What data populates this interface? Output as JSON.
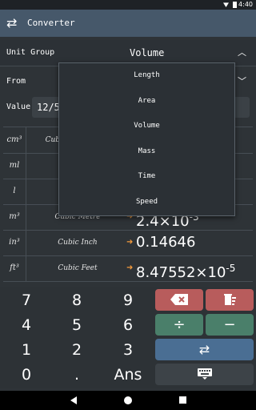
{
  "status": {
    "time": "4:40"
  },
  "app": {
    "title": "Converter",
    "icon": "swap-arrows-icon"
  },
  "unit_group": {
    "label": "Unit Group",
    "value": "Volume",
    "chevron": "^"
  },
  "from": {
    "label": "From",
    "chevron": "⌄"
  },
  "value": {
    "label": "Value",
    "text": "12/5"
  },
  "results": [
    {
      "symbol": "cm³",
      "name": "Cubic Centimetre",
      "arrow": "➜",
      "value": ""
    },
    {
      "symbol": "ml",
      "name": "",
      "arrow": "",
      "value": ""
    },
    {
      "symbol": "l",
      "name": "",
      "arrow": "",
      "value": ""
    },
    {
      "symbol": "m³",
      "name": "Cubic Metre",
      "arrow": "➜",
      "value": "2.4×10",
      "exp": "-3"
    },
    {
      "symbol": "in³",
      "name": "Cubic Inch",
      "arrow": "➜",
      "value": "0.14646",
      "exp": ""
    },
    {
      "symbol": "ft³",
      "name": "Cubic Feet",
      "arrow": "➜",
      "value": "8.47552×10",
      "exp": "-5"
    }
  ],
  "dropdown": {
    "options": [
      "Length",
      "Area",
      "Volume",
      "Mass",
      "Time",
      "Speed"
    ]
  },
  "keypad": {
    "digits": [
      "7",
      "8",
      "9",
      "4",
      "5",
      "6",
      "1",
      "2",
      "3",
      "0",
      ".",
      "Ans"
    ],
    "divide": "÷",
    "minus": "−"
  },
  "colors": {
    "appbar": "#46586a",
    "backspace": "#b85c5c",
    "clear": "#b85c5c",
    "ops": "#4a7f6a",
    "swap": "#4a6e93",
    "keyboard": "#3d4348",
    "arrow": "#f39a3c"
  }
}
